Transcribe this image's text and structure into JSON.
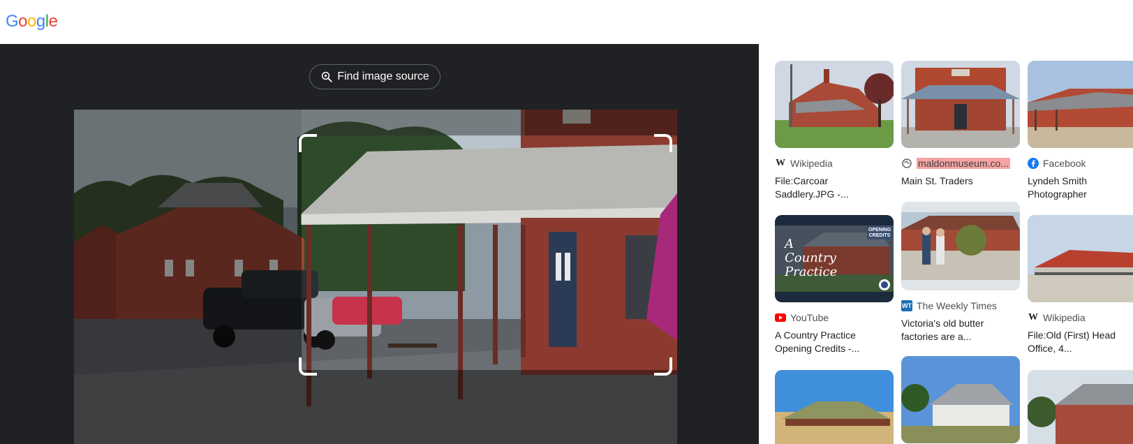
{
  "header": {
    "logo": [
      "G",
      "o",
      "o",
      "g",
      "l",
      "e"
    ],
    "logo_colors": [
      "#4285F4",
      "#EA4335",
      "#FBBC05",
      "#4285F4",
      "#34A853",
      "#EA4335"
    ]
  },
  "lens": {
    "find_source_label": "Find image source"
  },
  "results": [
    {
      "source": "Wikipedia",
      "title": "File:Carcoar Saddlery.JPG -...",
      "icon": "wikipedia-w-icon"
    },
    {
      "source": "maldonmuseum.co...",
      "title": "Main St. Traders",
      "icon": "globe-icon"
    },
    {
      "source": "Facebook",
      "title": "Lyndeh Smith Photographer",
      "icon": "facebook-icon"
    },
    {
      "source": "YouTube",
      "title": "A Country Practice Opening Credits -...",
      "icon": "youtube-icon"
    },
    {
      "source": "The Weekly Times",
      "title": "Victoria's old butter factories are a...",
      "icon": "weekly-times-icon"
    },
    {
      "source": "Wikipedia",
      "title": "File:Old (First) Head Office, 4...",
      "icon": "wikipedia-w-icon"
    }
  ],
  "thumb_overlay": {
    "badge": "OPENING CREDITS",
    "script_lines": [
      "A",
      "Country",
      "Practice"
    ]
  },
  "colors": {
    "dark_bg": "#202124",
    "highlight": "#f7a3a3"
  }
}
